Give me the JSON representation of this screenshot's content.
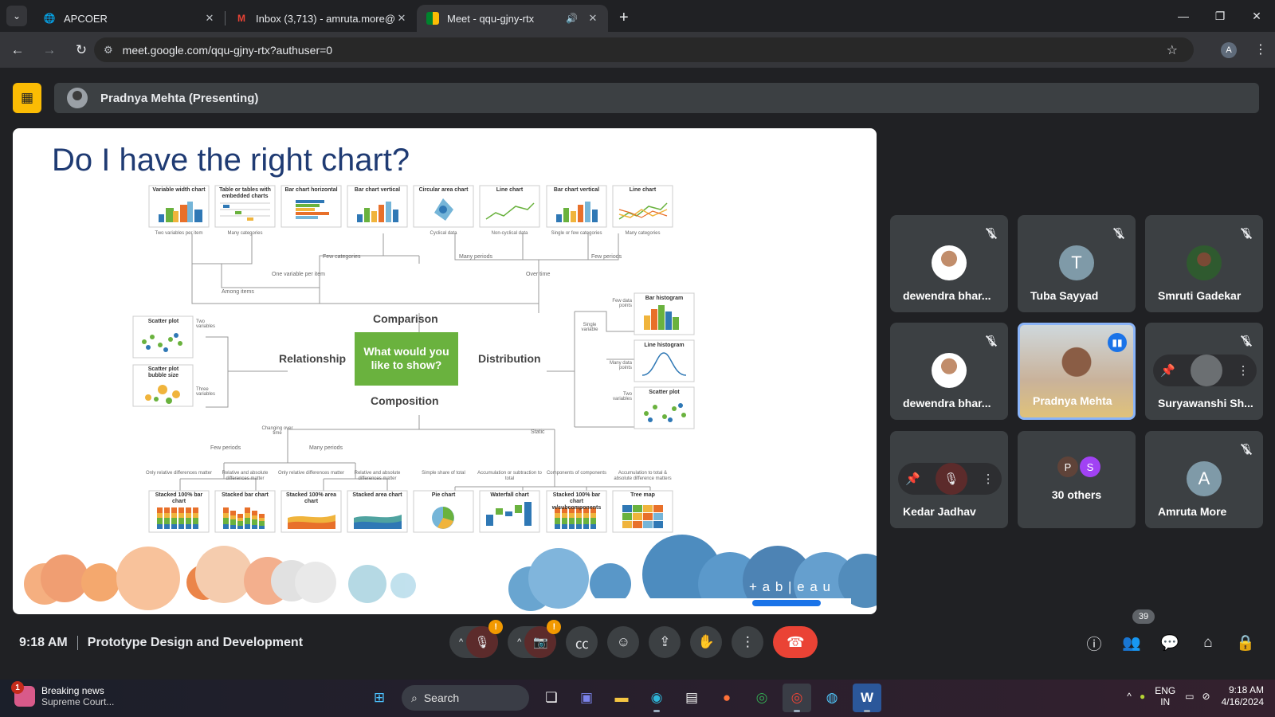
{
  "browser": {
    "tabs": [
      {
        "title": "APCOER",
        "icon": "globe-icon",
        "active": false
      },
      {
        "title": "Inbox (3,713) - amruta.more@a",
        "icon": "gmail-icon",
        "active": false
      },
      {
        "title": "Meet - qqu-gjny-rtx",
        "icon": "meet-icon",
        "active": true
      }
    ],
    "url": "meet.google.com/qqu-gjny-rtx?authuser=0",
    "profile_initial": "A"
  },
  "meet": {
    "presenter_label": "Pradnya Mehta (Presenting)",
    "meeting_time": "9:18 AM",
    "meeting_title": "Prototype Design and Development",
    "participant_count": "39",
    "warning_mark": "!",
    "participants": [
      {
        "name": "dewendra bhar...",
        "initial": "",
        "muted": true
      },
      {
        "name": "Tuba Sayyad",
        "initial": "T",
        "muted": true
      },
      {
        "name": "Smruti Gadekar",
        "initial": "",
        "muted": true
      },
      {
        "name": "dewendra bhar...",
        "initial": "",
        "muted": true
      },
      {
        "name": "Pradnya Mehta",
        "initial": "",
        "muted": false,
        "speaking": true
      },
      {
        "name": "Suryawanshi Sh...",
        "initial": "",
        "muted": true
      },
      {
        "name": "Kedar Jadhav",
        "initial": "",
        "muted": false
      },
      {
        "name": "30 others",
        "initials": [
          "P",
          "S"
        ]
      },
      {
        "name": "Amruta More",
        "initial": "A",
        "muted": true
      }
    ]
  },
  "slide": {
    "title": "Do I have the right chart?",
    "center": "What would you like to show?",
    "branches": {
      "comparison": "Comparison",
      "relationship": "Relationship",
      "distribution": "Distribution",
      "composition": "Composition"
    },
    "top_cards": [
      {
        "label": "Variable width chart",
        "sub": "Two variables per item"
      },
      {
        "label": "Table or tables with embedded charts",
        "sub": "Many categories"
      },
      {
        "label": "Bar chart horizontal",
        "sub": ""
      },
      {
        "label": "Bar chart vertical",
        "sub": ""
      },
      {
        "label": "Circular area chart",
        "sub": "Cyclical data"
      },
      {
        "label": "Line chart",
        "sub": "Non-cyclical data"
      },
      {
        "label": "Bar chart vertical",
        "sub": "Single or few categories"
      },
      {
        "label": "Line chart",
        "sub": "Many categories"
      }
    ],
    "top_labels": {
      "few_categories": "Few categories",
      "many_periods": "Many periods",
      "few_periods": "Few periods",
      "one_variable": "One variable per item",
      "over_time": "Over time",
      "among_items": "Among items"
    },
    "left_cards": [
      {
        "label": "Scatter plot",
        "sub": "Two variables"
      },
      {
        "label": "Scatter plot bubble size",
        "sub": "Three variables"
      }
    ],
    "right_cards": [
      {
        "label": "Bar histogram",
        "sub": "Few data points"
      },
      {
        "label": "Line histogram",
        "sub": "Many data points"
      },
      {
        "label": "Scatter plot",
        "sub": "Two variables"
      }
    ],
    "right_labels": {
      "single_variable": "Single variable"
    },
    "bottom_labels": {
      "changing": "Changing over time",
      "static": "Static",
      "few_periods": "Few periods",
      "many_periods": "Many periods"
    },
    "bottom_cards": [
      {
        "label": "Stacked 100% bar chart",
        "sub": "Only relative differences matter"
      },
      {
        "label": "Stacked bar chart",
        "sub": "Relative and absolute differences matter"
      },
      {
        "label": "Stacked 100% area chart",
        "sub": "Only relative differences matter"
      },
      {
        "label": "Stacked area chart",
        "sub": "Relative and absolute differences matter"
      },
      {
        "label": "Pie chart",
        "sub": "Simple share of total"
      },
      {
        "label": "Waterfall chart",
        "sub": "Accumulation or subtraction to total"
      },
      {
        "label": "Stacked 100% bar chart w/subcomponents",
        "sub": "Components of components"
      },
      {
        "label": "Tree map",
        "sub": "Accumulation to total & absolute difference matters"
      }
    ],
    "brand": "+ a b | e a u"
  },
  "taskbar": {
    "news_title": "Breaking news",
    "news_sub": "Supreme Court...",
    "news_badge": "1",
    "search_label": "Search",
    "lang1": "ENG",
    "lang2": "IN",
    "time": "9:18 AM",
    "date": "4/16/2024"
  },
  "colors": {
    "accent": "#1a73e8",
    "end_call": "#ea4335",
    "present_badge": "#fbbc04",
    "slide_green": "#6ab23e",
    "slide_title": "#1f3b73"
  }
}
